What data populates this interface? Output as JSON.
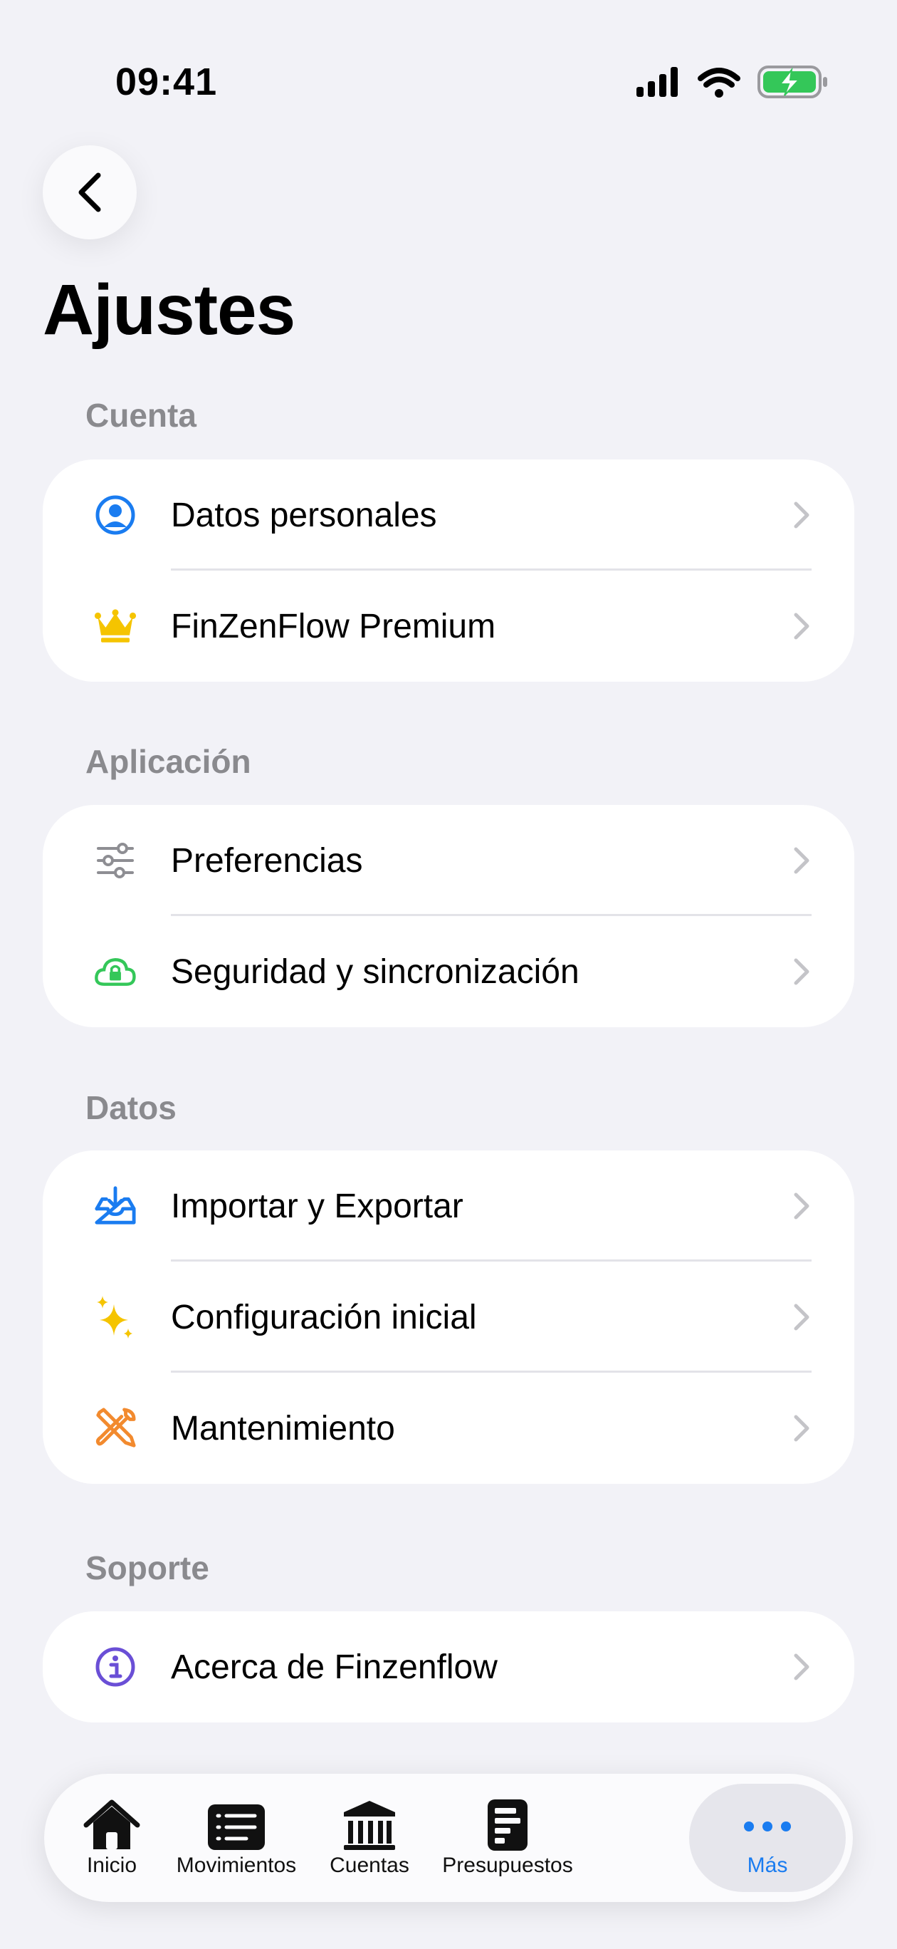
{
  "status_bar": {
    "time": "09:41"
  },
  "header": {
    "title": "Ajustes"
  },
  "colors": {
    "accent": "#1a7cf0",
    "premium": "#f5c400",
    "security": "#34c759",
    "maintenance": "#f28a2e",
    "info": "#6a4fd6"
  },
  "sections": [
    {
      "title": "Cuenta",
      "items": [
        {
          "label": "Datos personales",
          "icon": "person-circle-icon"
        },
        {
          "label": "FinZenFlow Premium",
          "icon": "crown-icon"
        }
      ]
    },
    {
      "title": "Aplicación",
      "items": [
        {
          "label": "Preferencias",
          "icon": "sliders-icon"
        },
        {
          "label": "Seguridad y sincronización",
          "icon": "cloud-lock-icon"
        }
      ]
    },
    {
      "title": "Datos",
      "items": [
        {
          "label": "Importar y Exportar",
          "icon": "tray-download-icon"
        },
        {
          "label": "Configuración inicial",
          "icon": "sparkles-icon"
        },
        {
          "label": "Mantenimiento",
          "icon": "tools-icon"
        }
      ]
    },
    {
      "title": "Soporte",
      "items": [
        {
          "label": "Acerca de Finzenflow",
          "icon": "info-circle-icon"
        }
      ]
    }
  ],
  "tabbar": {
    "items": [
      {
        "label": "Inicio",
        "icon": "house-icon"
      },
      {
        "label": "Movimientos",
        "icon": "list-icon"
      },
      {
        "label": "Cuentas",
        "icon": "bank-icon"
      },
      {
        "label": "Presupuestos",
        "icon": "budget-doc-icon"
      },
      {
        "label": "Más",
        "icon": "more-dots-icon"
      }
    ],
    "active": "Más"
  }
}
